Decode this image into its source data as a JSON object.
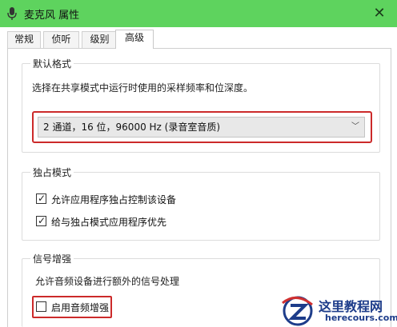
{
  "window": {
    "title": "麦克风 属性",
    "close_glyph": "✕"
  },
  "tabs": [
    {
      "label": "常规"
    },
    {
      "label": "侦听"
    },
    {
      "label": "级别"
    },
    {
      "label": "高级"
    }
  ],
  "default_format": {
    "legend": "默认格式",
    "description": "选择在共享模式中运行时使用的采样频率和位深度。",
    "selected": "2 通道，16 位，96000 Hz (录音室音质)"
  },
  "exclusive_mode": {
    "legend": "独占模式",
    "options": [
      {
        "label": "允许应用程序独占控制该设备",
        "checked": true
      },
      {
        "label": "给与独占模式应用程序优先",
        "checked": true
      }
    ]
  },
  "signal_enhancement": {
    "legend": "信号增强",
    "description": "允许音频设备进行额外的信号处理",
    "option": {
      "label": "启用音频增强",
      "checked": false
    }
  },
  "watermark": {
    "title": "这里教程网",
    "url": "herecours.com"
  },
  "colors": {
    "titlebar": "#5ed35e",
    "highlight": "#cc2a2a",
    "watermark": "#1d3c8a"
  }
}
